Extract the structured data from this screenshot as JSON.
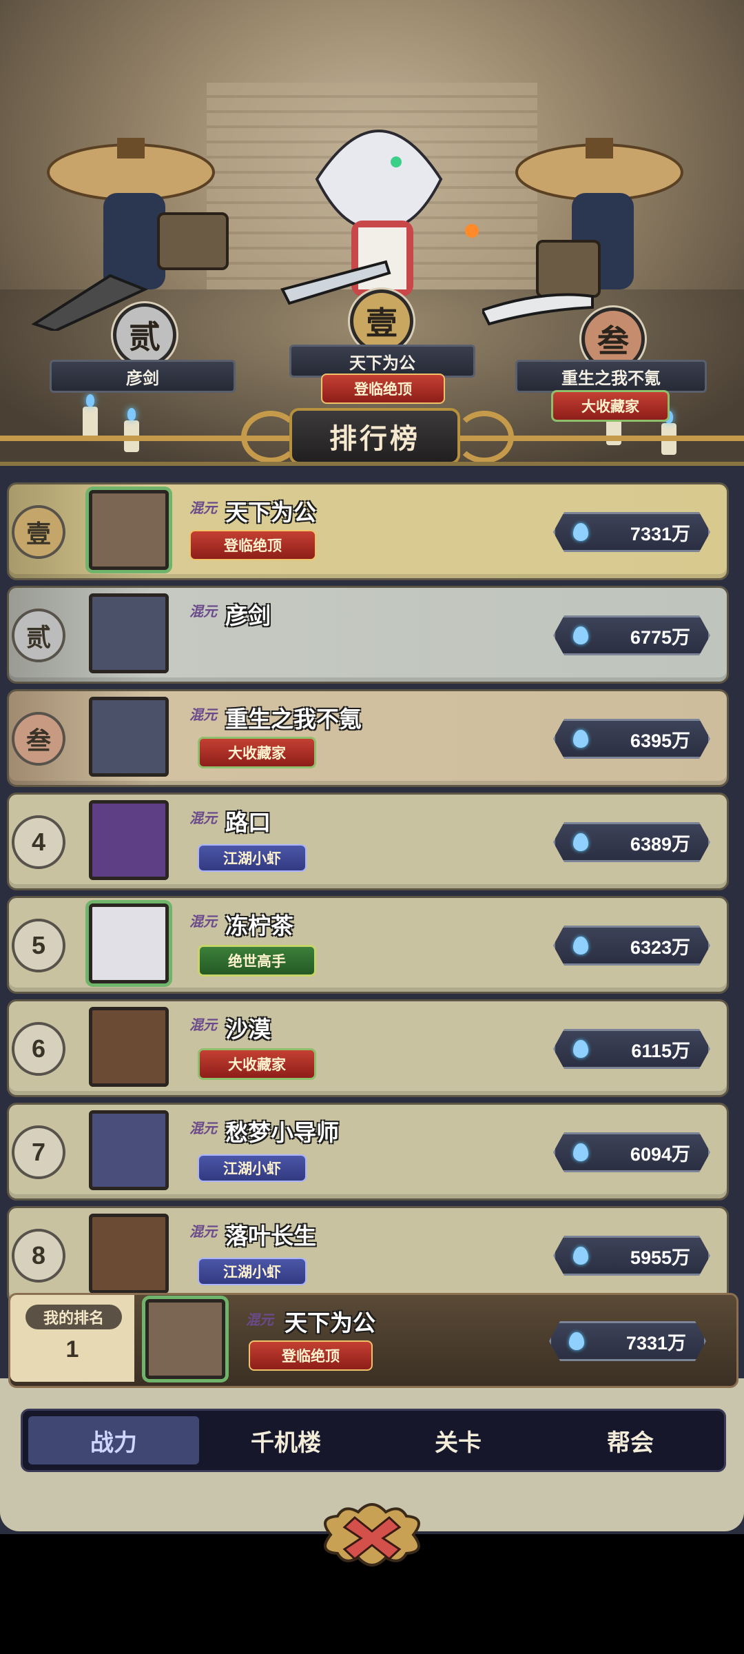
{
  "podium": [
    {
      "rank_glyph": "贰",
      "name": "彦剑",
      "badge": ""
    },
    {
      "rank_glyph": "壹",
      "name": "天下为公",
      "badge": "登临绝顶"
    },
    {
      "rank_glyph": "叁",
      "name": "重生之我不氪",
      "badge": "大收藏家"
    }
  ],
  "title": "排行榜",
  "hun_tag": "混元",
  "rows": [
    {
      "rank": "壹",
      "name": "天下为公",
      "badge": "登临绝顶",
      "power": "7331万"
    },
    {
      "rank": "贰",
      "name": "彦剑",
      "badge": "",
      "power": "6775万"
    },
    {
      "rank": "叁",
      "name": "重生之我不氪",
      "badge": "大收藏家",
      "power": "6395万"
    },
    {
      "rank": "4",
      "name": "路口",
      "badge": "江湖小虾",
      "power": "6389万"
    },
    {
      "rank": "5",
      "name": "冻柠茶",
      "badge": "绝世高手",
      "power": "6323万"
    },
    {
      "rank": "6",
      "name": "沙漠",
      "badge": "大收藏家",
      "power": "6115万"
    },
    {
      "rank": "7",
      "name": "愁梦小导师",
      "badge": "江湖小虾",
      "power": "6094万"
    },
    {
      "rank": "8",
      "name": "落叶长生",
      "badge": "江湖小虾",
      "power": "5955万"
    }
  ],
  "my_rank": {
    "label": "我的排名",
    "rank": "1",
    "name": "天下为公",
    "badge": "登临绝顶",
    "power": "7331万"
  },
  "tabs": [
    "战力",
    "千机楼",
    "关卡",
    "帮会"
  ],
  "active_tab": "战力",
  "icons": [
    "flame-drop-icon",
    "close-icon"
  ],
  "colors": {
    "gold_row": "#d8c98f",
    "silver_row": "#bfc4bd",
    "bronze_row": "#cdbd9d",
    "normal_row": "#c8c2a0",
    "accent_gold": "#c59b4b"
  }
}
